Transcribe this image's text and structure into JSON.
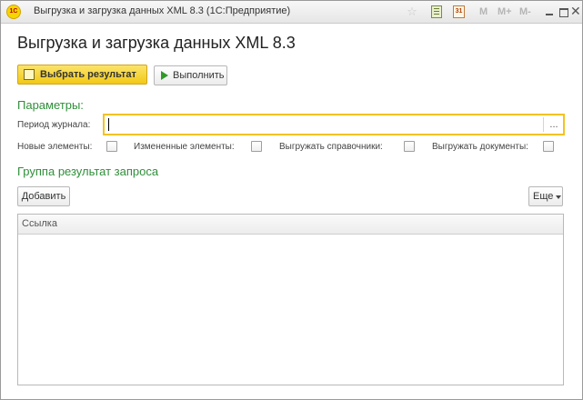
{
  "window": {
    "title": "Выгрузка и загрузка данных XML 8.3  (1С:Предприятие)",
    "logo_text": "1С",
    "toolbar_icons": [
      "star-icon",
      "calculator-icon",
      "calendar-icon"
    ],
    "calendar_text": "31",
    "memory_buttons": {
      "m": "M",
      "mplus": "M+",
      "mminus": "M-"
    },
    "close_glyph": "✕"
  },
  "form": {
    "title": "Выгрузка и загрузка данных XML 8.3",
    "select_result_label": "Выбрать результат",
    "run_label": "Выполнить"
  },
  "params": {
    "title": "Параметры:",
    "period_label": "Период журнала:",
    "period_value": "",
    "period_select_glyph": "...",
    "checkboxes": [
      {
        "label": "Новые элементы:",
        "checked": false
      },
      {
        "label": "Измененные элементы:",
        "checked": false
      },
      {
        "label": "Выгружать справочники:",
        "checked": false
      },
      {
        "label": "Выгружать документы:",
        "checked": false
      }
    ]
  },
  "group": {
    "title": "Группа результат запроса",
    "add_label": "Добавить",
    "more_label": "Еще",
    "table": {
      "columns": [
        "Ссылка"
      ],
      "rows": []
    }
  },
  "colors": {
    "accent": "#f3c224",
    "section_title": "#2f8f3a",
    "primary_button": "#f2c916"
  }
}
